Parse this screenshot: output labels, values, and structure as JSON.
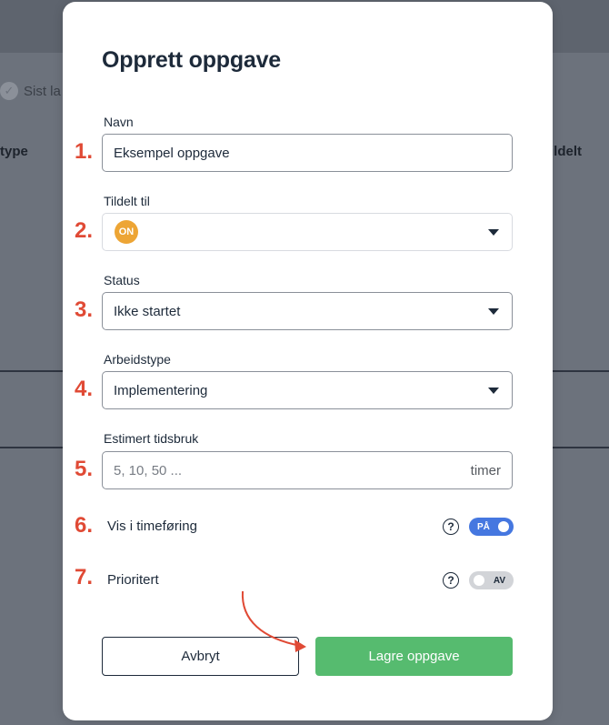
{
  "background": {
    "status_text": "Sist la",
    "column_left": "type",
    "column_right": "ildelt"
  },
  "modal": {
    "title": "Opprett oppgave",
    "fields": {
      "name": {
        "label": "Navn",
        "value": "Eksempel oppgave",
        "number": "1."
      },
      "assigned": {
        "label": "Tildelt til",
        "avatar_initials": "ON",
        "number": "2."
      },
      "status": {
        "label": "Status",
        "value": "Ikke startet",
        "number": "3."
      },
      "work_type": {
        "label": "Arbeidstype",
        "value": "Implementering",
        "number": "4."
      },
      "estimate": {
        "label": "Estimert tidsbruk",
        "placeholder": "5, 10, 50 ...",
        "suffix": "timer",
        "number": "5."
      }
    },
    "toggles": {
      "timesheet": {
        "label": "Vis i timeføring",
        "state_label": "PÅ",
        "number": "6.",
        "on": true
      },
      "priority": {
        "label": "Prioritert",
        "state_label": "AV",
        "number": "7.",
        "on": false
      }
    },
    "buttons": {
      "cancel": "Avbryt",
      "save": "Lagre oppgave"
    },
    "help_icon_glyph": "?"
  },
  "colors": {
    "annotation": "#e04a35",
    "toggle_on": "#4577e0",
    "save_button": "#56bb6f",
    "avatar": "#eda535"
  }
}
